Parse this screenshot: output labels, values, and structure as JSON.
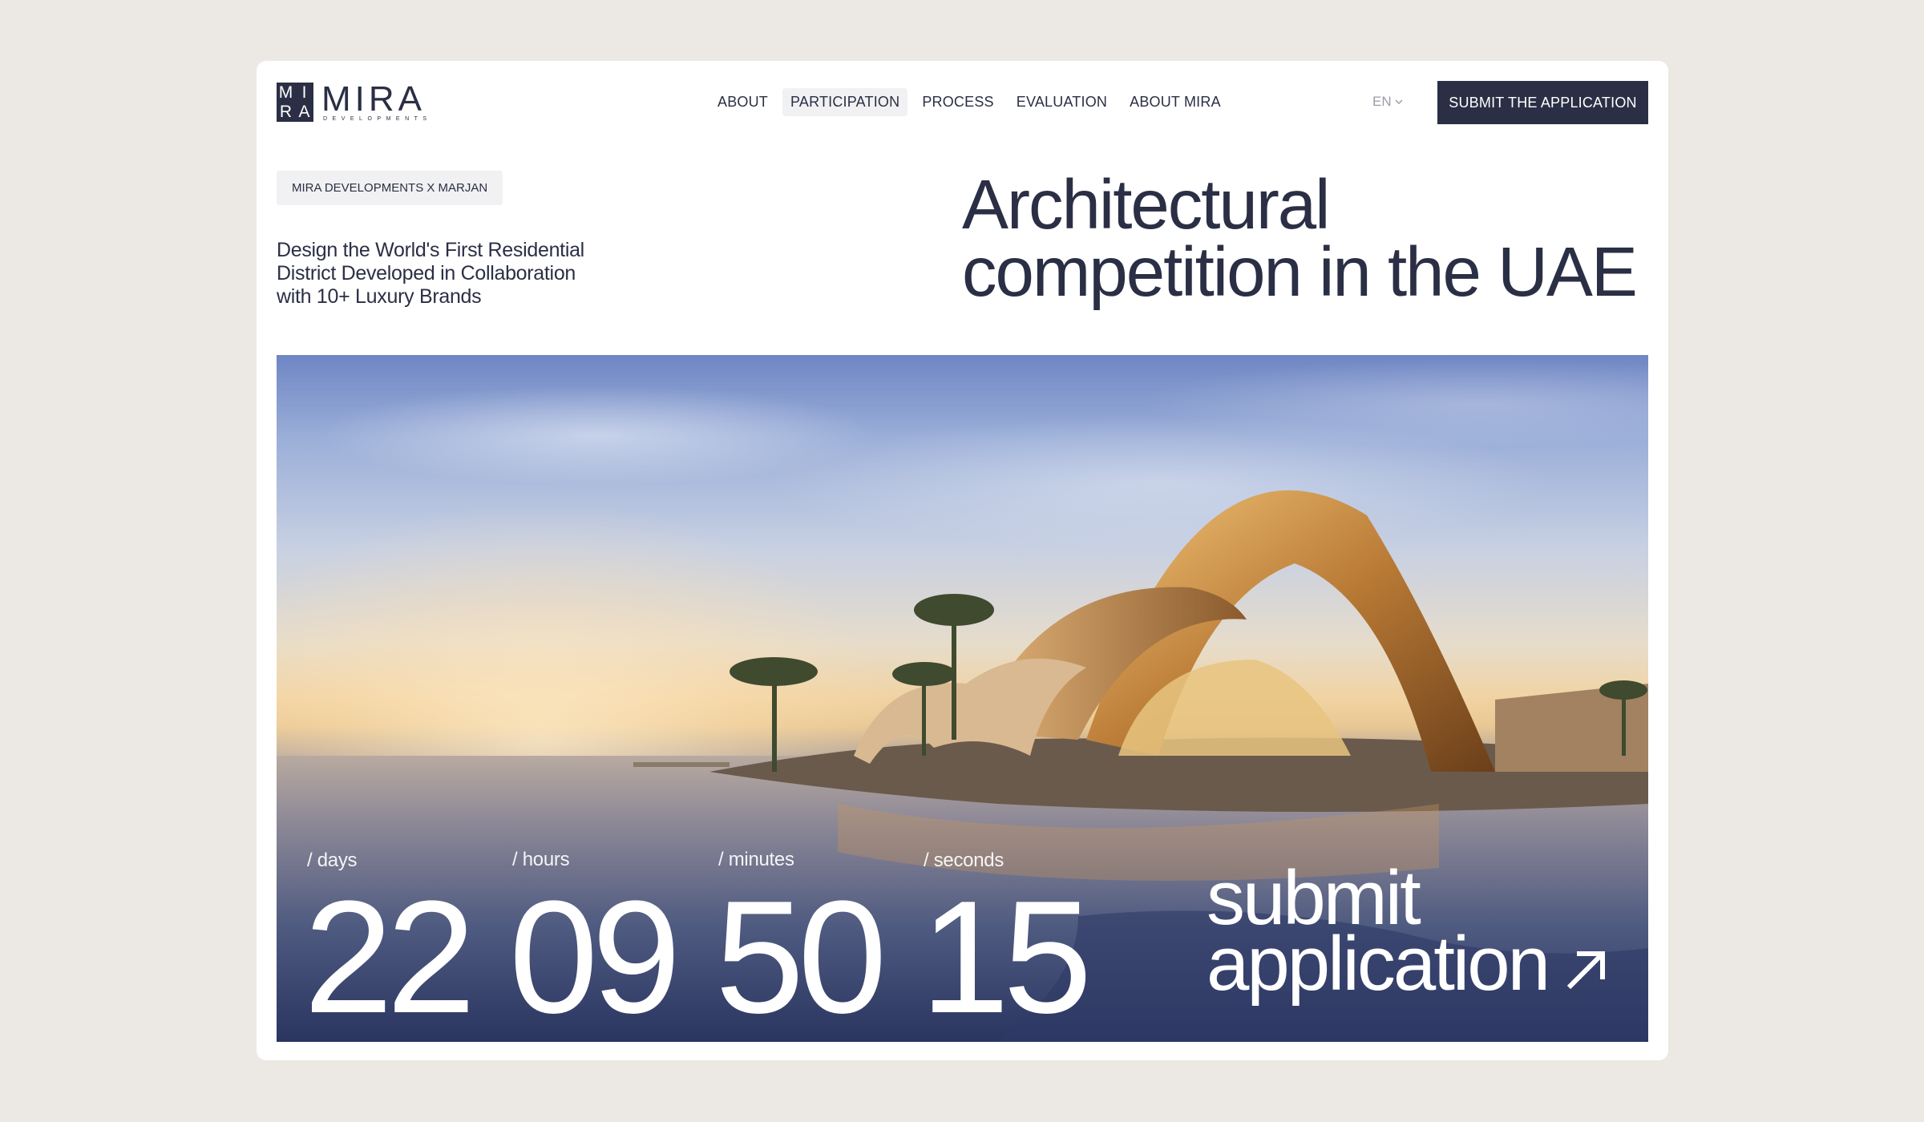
{
  "brand": {
    "mark_letters": [
      "M",
      "I",
      "R",
      "A"
    ],
    "name": "MIRA",
    "sub": "DEVELOPMENTS"
  },
  "nav": {
    "items": [
      {
        "label": "ABOUT"
      },
      {
        "label": "PARTICIPATION",
        "active": true
      },
      {
        "label": "PROCESS"
      },
      {
        "label": "EVALUATION"
      },
      {
        "label": "ABOUT MIRA"
      }
    ]
  },
  "language": {
    "label": "EN",
    "icon": "chevron-down-icon"
  },
  "header_cta": {
    "label": "SUBMIT THE APPLICATION"
  },
  "intro": {
    "tag": "MIRA DEVELOPMENTS X MARJAN",
    "lede": "Design the World's First Residential District Developed in Collaboration with 10+ Luxury Brands",
    "headline": "Architectural competition in the UAE"
  },
  "countdown": {
    "days": {
      "label": "/ days",
      "value": "22"
    },
    "hours": {
      "label": "/ hours",
      "value": "09"
    },
    "minutes": {
      "label": "/ minutes",
      "value": "50"
    },
    "seconds": {
      "label": "/ seconds",
      "value": "15"
    }
  },
  "hero_cta": {
    "line1": "submit",
    "line2": "application",
    "icon": "arrow-up-right-icon"
  },
  "colors": {
    "navy": "#2b2f45",
    "page_bg": "#ece9e4",
    "tag_bg": "#f1f1f3"
  }
}
